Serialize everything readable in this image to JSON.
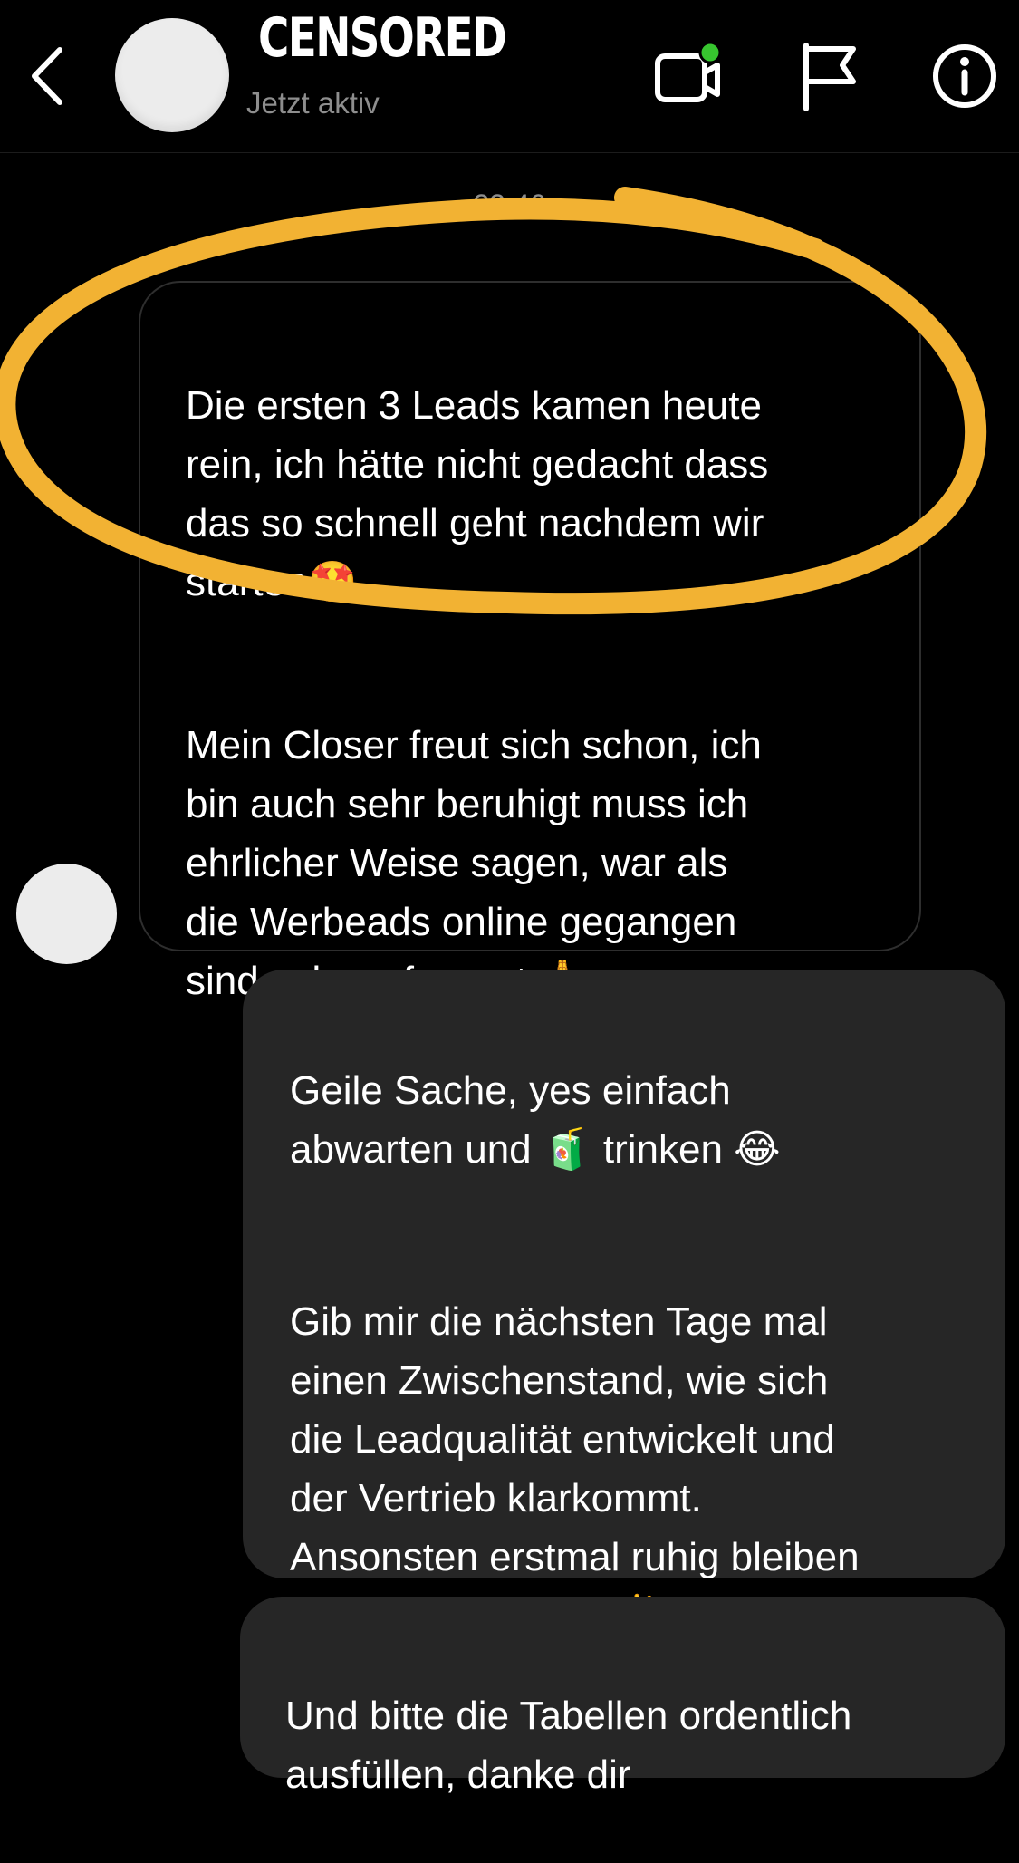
{
  "header": {
    "name": "CENSORED",
    "status": "Jetzt aktiv",
    "icons": [
      "back-arrow-icon",
      "video-call-icon",
      "flag-icon",
      "info-icon"
    ],
    "online_dot_color": "#37c52f"
  },
  "conversation": {
    "timestamp": "23:46",
    "incoming": {
      "paragraph1": "Die ersten 3 Leads kamen heute\nrein, ich hätte nicht gedacht dass\ndas so schnell geht nachdem wir\nstarten🤩",
      "paragraph2": "Mein Closer freut sich schon, ich\nbin auch sehr beruhigt muss ich\nehrlicher Weise sagen, war als\ndie Werbeads online gegangen\nsind sehr aufgeregt 🙏"
    },
    "outgoing": [
      {
        "paragraph1": "Geile Sache, yes einfach\nabwarten und 🧃 trinken 😂",
        "paragraph2": "Gib mir die nächsten Tage mal\neinen Zwischenstand, wie sich\ndie Leadqualität entwickelt und\nder Vertrieb klarkommt.\nAnsonsten erstmal ruhig bleiben\nund laufen lassen ✌️"
      },
      {
        "text": "Und bitte die Tabellen ordentlich\nausfüllen, danke dir"
      }
    ]
  },
  "colors": {
    "background": "#000000",
    "outgoing_bubble": "#262626",
    "incoming_border": "#2e2e2e",
    "highlight": "#f2b233",
    "muted_text": "#8e8e8e"
  }
}
